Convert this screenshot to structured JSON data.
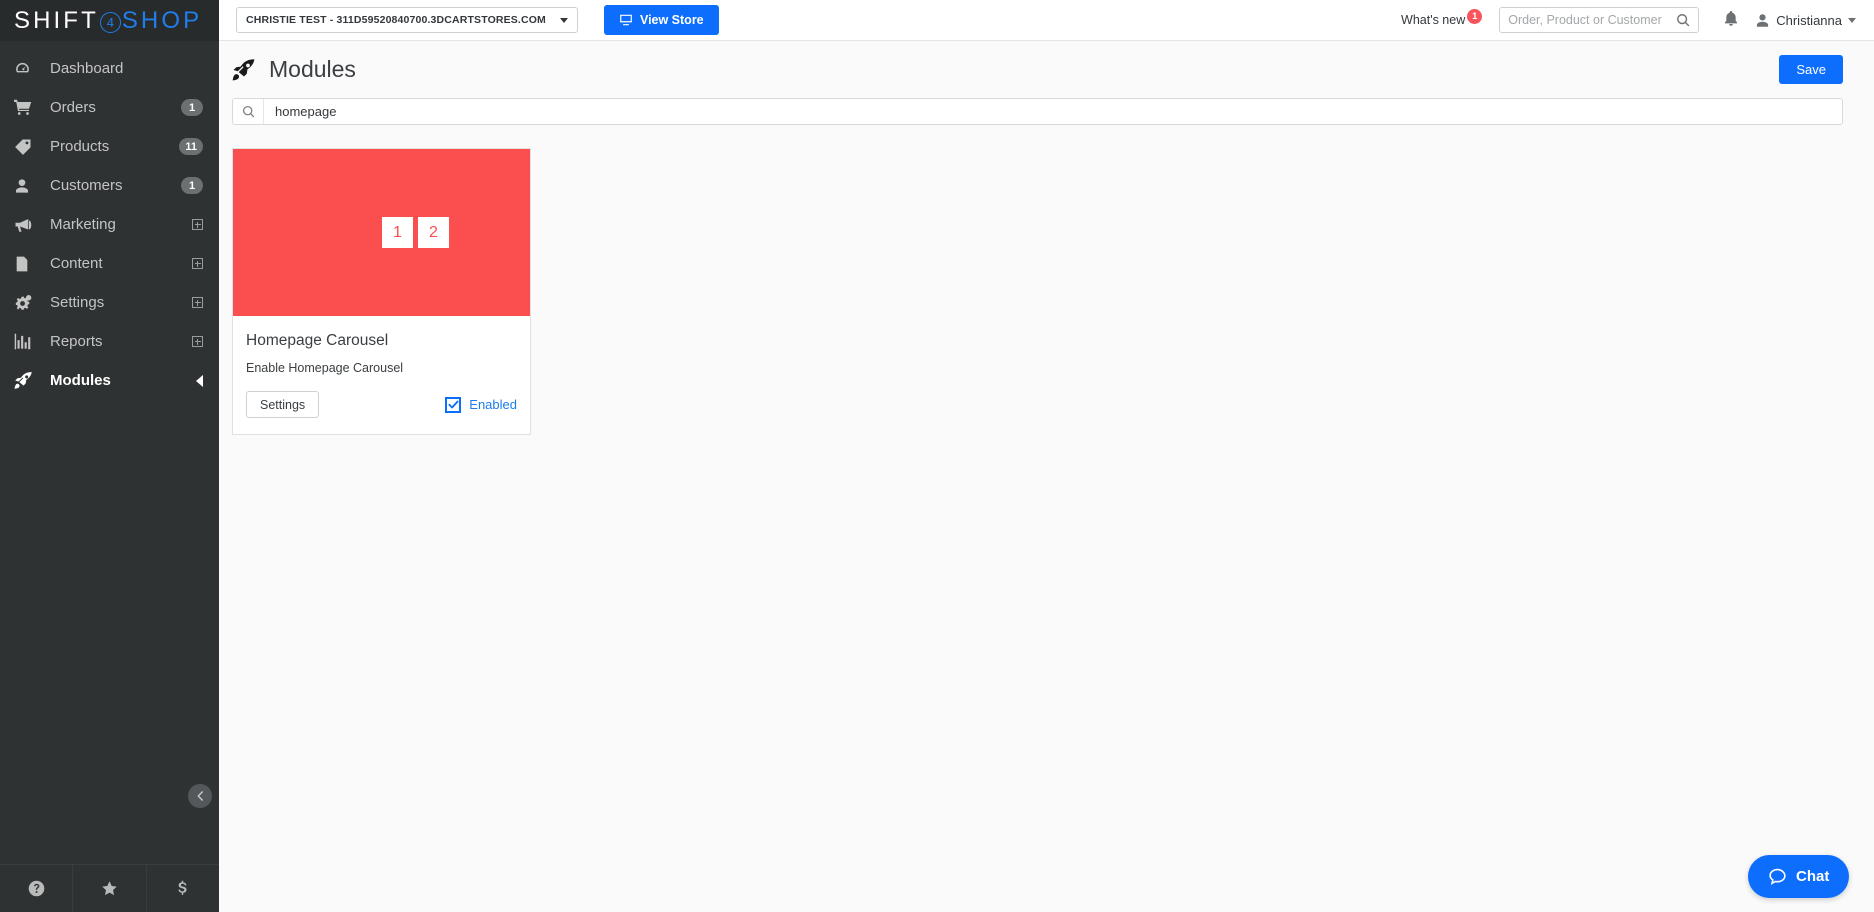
{
  "brand": {
    "logo_part1": "SHIFT",
    "logo_number": "4",
    "logo_part2": "SHOP"
  },
  "colors": {
    "accent_blue": "#0d6efd",
    "link_blue": "#1f7dec",
    "sidebar_bg": "#2f3233",
    "thumb_red": "#fb4f4f",
    "badge_red": "#f8545c"
  },
  "topbar": {
    "store_name": "CHRISTIE TEST - 311D59520840700.3DCARTSTORES.COM",
    "view_store_label": "View Store",
    "whats_new_label": "What's new",
    "whats_new_count": "1",
    "search_placeholder": "Order, Product or Customer",
    "search_value": "",
    "user_name": "Christianna"
  },
  "sidebar": {
    "items": [
      {
        "label": "Dashboard",
        "icon": "dashboard-icon",
        "badge": null,
        "expand": false,
        "active": false
      },
      {
        "label": "Orders",
        "icon": "cart-icon",
        "badge": "1",
        "expand": false,
        "active": false
      },
      {
        "label": "Products",
        "icon": "tag-icon",
        "badge": "11",
        "expand": false,
        "active": false
      },
      {
        "label": "Customers",
        "icon": "user-icon",
        "badge": "1",
        "expand": false,
        "active": false
      },
      {
        "label": "Marketing",
        "icon": "megaphone-icon",
        "badge": null,
        "expand": true,
        "active": false
      },
      {
        "label": "Content",
        "icon": "document-icon",
        "badge": null,
        "expand": true,
        "active": false
      },
      {
        "label": "Settings",
        "icon": "gears-icon",
        "badge": null,
        "expand": true,
        "active": false
      },
      {
        "label": "Reports",
        "icon": "bar-chart-icon",
        "badge": null,
        "expand": true,
        "active": false
      },
      {
        "label": "Modules",
        "icon": "rocket-icon",
        "badge": null,
        "expand": false,
        "active": true
      }
    ],
    "footer_icons": [
      "help-icon",
      "star-icon",
      "dollar-icon"
    ],
    "collapse_icon": "collapse-left-icon"
  },
  "page": {
    "title": "Modules",
    "title_icon": "rocket-icon",
    "save_label": "Save",
    "search_placeholder": "",
    "search_value": "homepage"
  },
  "modules": [
    {
      "title": "Homepage Carousel",
      "description": "Enable Homepage Carousel",
      "settings_label": "Settings",
      "enabled_label": "Enabled",
      "enabled": true,
      "thumb_slide_1": "1",
      "thumb_slide_2": "2"
    }
  ],
  "chat": {
    "label": "Chat",
    "icon": "chat-bubble-icon"
  }
}
